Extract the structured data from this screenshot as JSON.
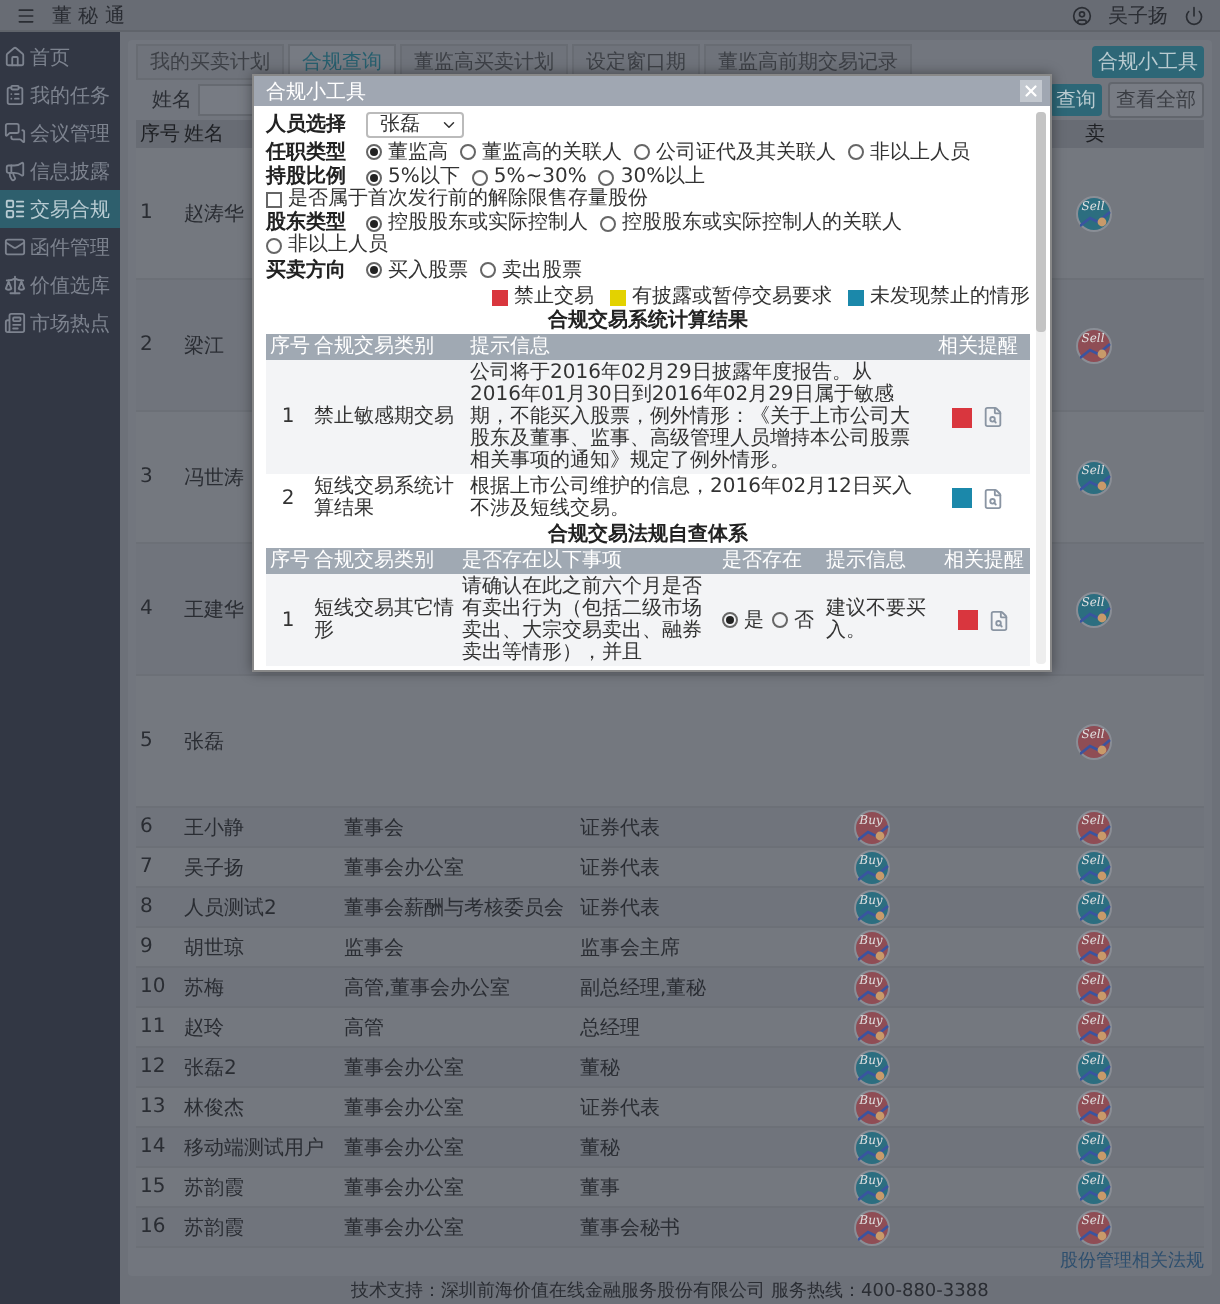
{
  "header": {
    "title": "董 秘 通",
    "user": "吴子扬"
  },
  "sidebar": {
    "items": [
      {
        "label": "首页",
        "selected": false
      },
      {
        "label": "我的任务",
        "selected": false
      },
      {
        "label": "会议管理",
        "selected": false
      },
      {
        "label": "信息披露",
        "selected": false
      },
      {
        "label": "交易合规",
        "selected": true
      },
      {
        "label": "函件管理",
        "selected": false
      },
      {
        "label": "价值选库",
        "selected": false
      },
      {
        "label": "市场热点",
        "selected": false
      }
    ]
  },
  "tabs": [
    {
      "label": "我的买卖计划",
      "selected": false
    },
    {
      "label": "合规查询",
      "selected": true
    },
    {
      "label": "董监高买卖计划",
      "selected": false
    },
    {
      "label": "设定窗口期",
      "selected": false
    },
    {
      "label": "董监高前期交易记录",
      "selected": false
    }
  ],
  "tool_button": "合规小工具",
  "search": {
    "label": "姓名",
    "buttons": [
      "查询",
      "查看全部"
    ]
  },
  "table": {
    "columns": {
      "index": "序号",
      "name": "姓名",
      "sell": "卖"
    },
    "rows": [
      {
        "index": "1",
        "name": "赵涛华",
        "sell": {
          "text": "Sell",
          "color": "#2c6e80"
        }
      },
      {
        "index": "2",
        "name": "梁江",
        "sell": {
          "text": "Sell",
          "color": "#8f4d55"
        }
      },
      {
        "index": "3",
        "name": "冯世涛",
        "sell": {
          "text": "Sell",
          "color": "#2c6e80"
        }
      },
      {
        "index": "4",
        "name": "王建华",
        "sell": {
          "text": "Sell",
          "color": "#2c6e80"
        }
      },
      {
        "index": "5",
        "name": "张磊",
        "sell": {
          "text": "Sell",
          "color": "#8f4d55"
        }
      },
      {
        "index": "6",
        "name": "王小静",
        "department": "董事会",
        "position": "证券代表",
        "buy": {
          "text": "Buy",
          "color": "#8f4d55"
        },
        "sell": {
          "text": "Sell",
          "color": "#8f4d55"
        }
      },
      {
        "index": "7",
        "name": "吴子扬",
        "department": "董事会办公室",
        "position": "证券代表",
        "buy": {
          "text": "Buy",
          "color": "#2c6e80"
        },
        "sell": {
          "text": "Sell",
          "color": "#2c6e80"
        }
      },
      {
        "index": "8",
        "name": "人员测试2",
        "department": "董事会薪酬与考核委员会",
        "position": "证券代表",
        "buy": {
          "text": "Buy",
          "color": "#2c6e80"
        },
        "sell": {
          "text": "Sell",
          "color": "#2c6e80"
        }
      },
      {
        "index": "9",
        "name": "胡世琼",
        "department": "监事会",
        "position": "监事会主席",
        "buy": {
          "text": "Buy",
          "color": "#8f4d55"
        },
        "sell": {
          "text": "Sell",
          "color": "#8f4d55"
        }
      },
      {
        "index": "10",
        "name": "苏梅",
        "department": "高管,董事会办公室",
        "position": "副总经理,董秘",
        "buy": {
          "text": "Buy",
          "color": "#8f4d55"
        },
        "sell": {
          "text": "Sell",
          "color": "#8f4d55"
        }
      },
      {
        "index": "11",
        "name": "赵玲",
        "department": "高管",
        "position": "总经理",
        "buy": {
          "text": "Buy",
          "color": "#8f4d55"
        },
        "sell": {
          "text": "Sell",
          "color": "#8f4d55"
        }
      },
      {
        "index": "12",
        "name": "张磊2",
        "department": "董事会办公室",
        "position": "董秘",
        "buy": {
          "text": "Buy",
          "color": "#2c6e80"
        },
        "sell": {
          "text": "Sell",
          "color": "#2c6e80"
        }
      },
      {
        "index": "13",
        "name": "林俊杰",
        "department": "董事会办公室",
        "position": "证券代表",
        "buy": {
          "text": "Buy",
          "color": "#8f4d55"
        },
        "sell": {
          "text": "Sell",
          "color": "#8f4d55"
        }
      },
      {
        "index": "14",
        "name": "移动端测试用户",
        "department": "董事会办公室",
        "position": "董秘",
        "buy": {
          "text": "Buy",
          "color": "#2c6e80"
        },
        "sell": {
          "text": "Sell",
          "color": "#2c6e80"
        }
      },
      {
        "index": "15",
        "name": "苏韵霞",
        "department": "董事会办公室",
        "position": "董事",
        "buy": {
          "text": "Buy",
          "color": "#2c6e80"
        },
        "sell": {
          "text": "Sell",
          "color": "#2c6e80"
        }
      },
      {
        "index": "16",
        "name": "苏韵霞",
        "department": "董事会办公室",
        "position": "董事会秘书",
        "buy": {
          "text": "Buy",
          "color": "#8f4d55"
        },
        "sell": {
          "text": "Sell",
          "color": "#8f4d55"
        }
      }
    ]
  },
  "law_link": "股份管理相关法规",
  "footer": "技术支持：深圳前海价值在线金融服务股份有限公司 服务热线：400-880-3388",
  "modal": {
    "title": "合规小工具",
    "person": {
      "label": "人员选择",
      "value": "张磊"
    },
    "radio_groups": [
      {
        "label": "任职类型",
        "options": [
          {
            "label": "董监高",
            "selected": true
          },
          {
            "label": "董监高的关联人",
            "selected": false
          },
          {
            "label": "公司证代及其关联人",
            "selected": false
          },
          {
            "label": "非以上人员",
            "selected": false
          }
        ]
      },
      {
        "label": "持股比例",
        "options": [
          {
            "label": "5%以下",
            "selected": true
          },
          {
            "label": "5%~30%",
            "selected": false
          },
          {
            "label": "30%以上",
            "selected": false
          }
        ],
        "checkbox": {
          "label": "是否属于首次发行前的解除限售存量股份",
          "checked": false
        }
      },
      {
        "label": "股东类型",
        "options": [
          {
            "label": "控股股东或实际控制人",
            "selected": true
          },
          {
            "label": "控股股东或实际控制人的关联人",
            "selected": false
          },
          {
            "label": "非以上人员",
            "selected": false
          }
        ]
      },
      {
        "label": "买卖方向",
        "options": [
          {
            "label": "买入股票",
            "selected": true
          },
          {
            "label": "卖出股票",
            "selected": false
          }
        ]
      }
    ],
    "legend": [
      {
        "label": "禁止交易",
        "color": "#d9363e"
      },
      {
        "label": "有披露或暂停交易要求",
        "color": "#e3d200"
      },
      {
        "label": "未发现禁止的情形",
        "color": "#1b88aa"
      }
    ],
    "result_title": "合规交易系统计算结果",
    "result_table": {
      "columns": [
        "序号",
        "合规交易类别",
        "提示信息",
        "相关提醒"
      ],
      "rows": [
        {
          "index": "1",
          "category": "禁止敏感期交易",
          "message": "公司将于2016年02月29日披露年度报告。从2016年01月30日到2016年02月29日属于敏感期，不能买入股票，例外情形：《关于上市公司大股东及董事、监事、高级管理人员增持本公司股票相关事项的通知》规定了例外情形。",
          "color": "#d9363e"
        },
        {
          "index": "2",
          "category": "短线交易系统计算结果",
          "message": "根据上市公司维护的信息，2016年02月12日买入不涉及短线交易。",
          "color": "#1b88aa"
        }
      ]
    },
    "check_title": "合规交易法规自查体系",
    "check_table": {
      "columns": [
        "序号",
        "合规交易类别",
        "是否存在以下事项",
        "是否存在",
        "提示信息",
        "相关提醒"
      ],
      "rows": [
        {
          "index": "1",
          "category": "短线交易其它情形",
          "matter": "请确认在此之前六个月是否有卖出行为（包括二级市场卖出、大宗交易卖出、融券卖出等情形），并且",
          "options": [
            {
              "label": "是",
              "selected": true
            },
            {
              "label": "否",
              "selected": false
            }
          ],
          "message": "建议不要买入。",
          "color": "#d9363e"
        }
      ]
    }
  }
}
